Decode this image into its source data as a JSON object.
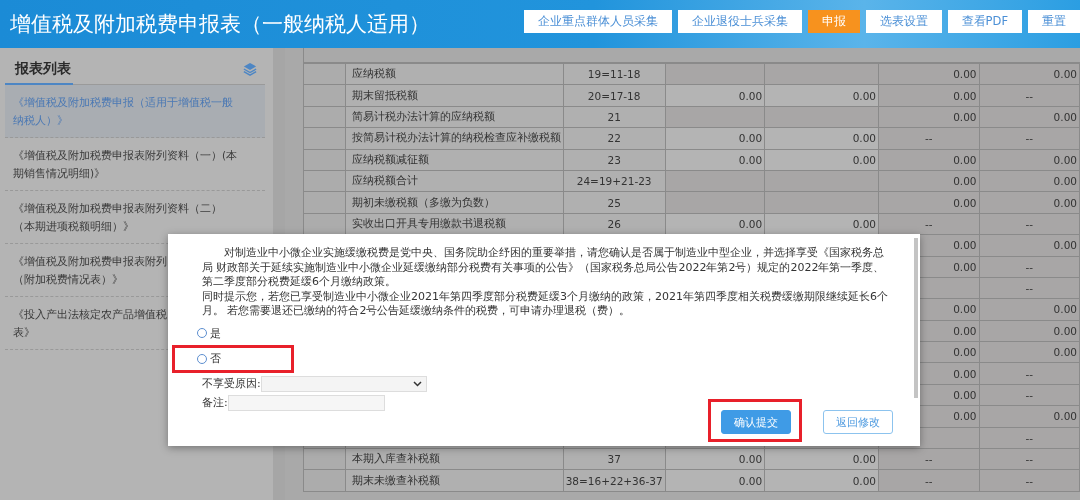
{
  "header": {
    "title": "增值税及附加税费申报表（一般纳税人适用）",
    "buttons": [
      {
        "label": "企业重点群体人员采集",
        "kind": "default"
      },
      {
        "label": "企业退役士兵采集",
        "kind": "default"
      },
      {
        "label": "申报",
        "kind": "primary"
      },
      {
        "label": "选表设置",
        "kind": "default"
      },
      {
        "label": "查看PDF",
        "kind": "default"
      },
      {
        "label": "重置",
        "kind": "default"
      }
    ]
  },
  "sidebar": {
    "title": "报表列表",
    "items": [
      {
        "lines": [
          "《增值税及附加税费申报（适用于增值税一般",
          "纳税人）》"
        ],
        "selected": true
      },
      {
        "lines": [
          "《增值税及附加税费申报表附列资料（一）(本",
          "期销售情况明细)》"
        ],
        "selected": false
      },
      {
        "lines": [
          "《增值税及附加税费申报表附列资料（二）",
          "（本期进项税额明细）》"
        ],
        "selected": false
      },
      {
        "lines": [
          "《增值税及附加税费申报表附列",
          "（附加税费情况表）》"
        ],
        "selected": false
      },
      {
        "lines": [
          "《投入产出法核定农产品增值税",
          "表》"
        ],
        "selected": false
      }
    ]
  },
  "table": {
    "rows": [
      {
        "label": "应纳税额",
        "line": "19=11-18",
        "column_5": "0.00",
        "column_6": "0.00"
      },
      {
        "label": "期末留抵税额",
        "line": "20=17-18",
        "column_3": "0.00",
        "column_4": "0.00",
        "column_5": "0.00",
        "column_6": "--"
      },
      {
        "label": "简易计税办法计算的应纳税额",
        "line": "21",
        "column_5": "0.00",
        "column_6": "0.00"
      },
      {
        "label": "按简易计税办法计算的纳税检查应补缴税额",
        "line": "22",
        "column_3": "0.00",
        "column_4": "0.00",
        "column_5": "--",
        "column_6": "--"
      },
      {
        "label": "应纳税额减征额",
        "line": "23",
        "column_3": "0.00",
        "column_4": "0.00",
        "column_5": "0.00",
        "column_6": "0.00"
      },
      {
        "label": "应纳税额合计",
        "line": "24=19+21-23",
        "column_5": "0.00",
        "column_6": "0.00"
      },
      {
        "label": "期初未缴税额（多缴为负数）",
        "line": "25",
        "column_5": "0.00",
        "column_6": "0.00"
      },
      {
        "label": "实收出口开具专用缴款书退税额",
        "line": "26",
        "column_3": "0.00",
        "column_4": "0.00",
        "column_5": "--",
        "column_6": "--"
      },
      {
        "column_5": "0.00",
        "column_6": "0.00"
      },
      {
        "column_5": "0.00",
        "column_6": "--"
      },
      {
        "column_6": "--"
      },
      {
        "column_5": "0.00",
        "column_6": "0.00"
      },
      {
        "column_5": "0.00",
        "column_6": "0.00"
      },
      {
        "column_5": "0.00",
        "column_6": "0.00"
      },
      {
        "column_5": "0.00",
        "column_6": "--"
      },
      {
        "column_5": "0.00",
        "column_6": "--"
      },
      {
        "column_5": "0.00",
        "column_6": "0.00"
      },
      {
        "column_6": "--"
      },
      {
        "label": "本期入库查补税额",
        "line": "37",
        "column_3": "0.00",
        "column_4": "0.00",
        "column_5": "--",
        "column_6": "--"
      },
      {
        "label": "期末未缴查补税额",
        "line": "38=16+22+36-37",
        "column_3": "0.00",
        "column_4": "0.00",
        "column_5": "--",
        "column_6": "--"
      }
    ]
  },
  "dialog": {
    "paragraphs": [
      "对制造业中小微企业实施缓缴税费是党中央、国务院助企纾困的重要举措，请您确认是否属于制造业中型企业，并选择享受《国家税务总局 财政部关于延续实施制造业中小微企业延缓缴纳部分税费有关事项的公告》（国家税务总局公告2022年第2号）规定的2022年第一季度、第二季度部分税费延缓6个月缴纳政策。",
      "同时提示您，若您已享受制造业中小微企业2021年第四季度部分税费延缓3个月缴纳的政策，2021年第四季度相关税费缓缴期限继续延长6个月。 若您需要退还已缴纳的符合2号公告延缓缴纳条件的税费，可申请办理退税（费）。"
    ],
    "options": [
      {
        "label": "是",
        "selected": false,
        "annotated": false
      },
      {
        "label": "否",
        "selected": false,
        "annotated": true
      }
    ],
    "reason": {
      "label": "不享受原因:"
    },
    "note": {
      "label": "备注:"
    },
    "buttons": [
      {
        "label": "确认提交",
        "kind": "primary",
        "annotated": true
      },
      {
        "label": "返回修改",
        "kind": "default",
        "annotated": false
      }
    ]
  }
}
